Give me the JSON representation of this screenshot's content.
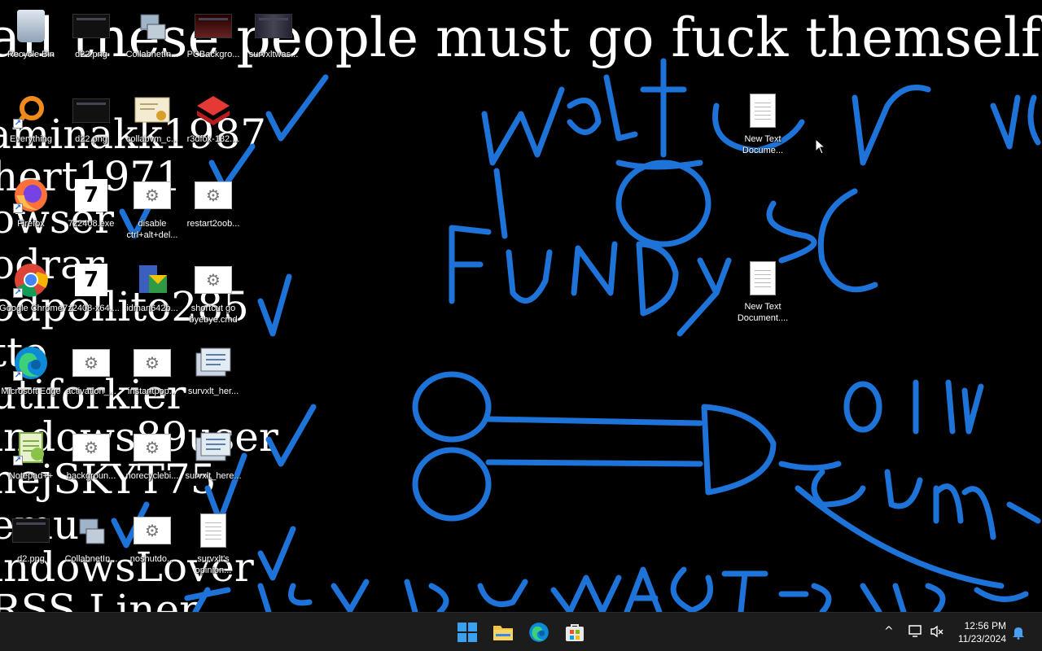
{
  "wallpaper": {
    "lines": [
      "all these people must go fuck themselfs",
      "aminakk1987",
      "hert1971",
      "owser",
      "odrar",
      "odpollito285",
      "tto",
      "utiforkier",
      "indows89user",
      "nejSKYT75",
      "emu",
      "indowsLover",
      "RSS Liner"
    ]
  },
  "desktop_icons": [
    {
      "label": "Recycle Bin",
      "icon": "recycle-bin-icon"
    },
    {
      "label": "d22.png",
      "icon": "image-thumbnail-icon"
    },
    {
      "label": "CollabnetIn...",
      "icon": "network-computer-icon"
    },
    {
      "label": "PCBackgro...",
      "icon": "image-thumbnail-icon"
    },
    {
      "label": "survxltwas...",
      "icon": "image-thumbnail-icon"
    },
    {
      "label": "Everything",
      "icon": "magnifier-icon"
    },
    {
      "label": "d22.png",
      "icon": "image-thumbnail-icon"
    },
    {
      "label": "collabvm_c...",
      "icon": "certificate-icon"
    },
    {
      "label": "r3dfox-132....",
      "icon": "r3dfox-icon"
    },
    {
      "label": "Firefox",
      "icon": "firefox-icon"
    },
    {
      "label": "7z2408.exe",
      "icon": "7zip-installer-icon"
    },
    {
      "label": "disable ctrl+alt+del...",
      "icon": "settings-file-icon"
    },
    {
      "label": "restart2oob...",
      "icon": "settings-file-icon"
    },
    {
      "label": "Google Chrome",
      "icon": "chrome-icon"
    },
    {
      "label": "7z2408-x64....",
      "icon": "7zip-installer-icon"
    },
    {
      "label": "idman642b...",
      "icon": "idm-installer-icon"
    },
    {
      "label": "shortcut go byebye.cmd",
      "icon": "settings-file-icon"
    },
    {
      "label": "Microsoft Edge",
      "icon": "edge-icon"
    },
    {
      "label": "activation_...",
      "icon": "settings-file-icon"
    },
    {
      "label": "instantpop...",
      "icon": "settings-file-icon"
    },
    {
      "label": "survxlt_her...",
      "icon": "registry-file-icon"
    },
    {
      "label": "Notepad++",
      "icon": "notepadpp-icon"
    },
    {
      "label": "backgroun...",
      "icon": "settings-file-icon"
    },
    {
      "label": "norecyclebi...",
      "icon": "settings-file-icon"
    },
    {
      "label": "survxlt_here...",
      "icon": "registry-file-icon"
    },
    {
      "label": "d2.png",
      "icon": "image-thumbnail-icon"
    },
    {
      "label": "CollabnetIn...",
      "icon": "network-computer-icon"
    },
    {
      "label": "noshutdo...",
      "icon": "settings-file-icon"
    },
    {
      "label": "survxlt's opinion...",
      "icon": "text-document-icon"
    },
    {
      "label": "New Text Docume...",
      "icon": "text-document-icon"
    },
    {
      "label": "New Text Document....",
      "icon": "text-document-icon"
    }
  ],
  "taskbar": {
    "pinned": [
      {
        "name": "start-button",
        "icon": "windows-logo-icon"
      },
      {
        "name": "file-explorer-button",
        "icon": "folder-icon"
      },
      {
        "name": "edge-taskbar-button",
        "icon": "edge-icon"
      },
      {
        "name": "store-button",
        "icon": "store-icon"
      }
    ],
    "tray_chevron": "^",
    "time": "12:56 PM",
    "date": "11/23/2024"
  },
  "colors": {
    "scribble": "#1e73d8",
    "taskbar": "#1c1c1c",
    "desktop": "#000000"
  }
}
